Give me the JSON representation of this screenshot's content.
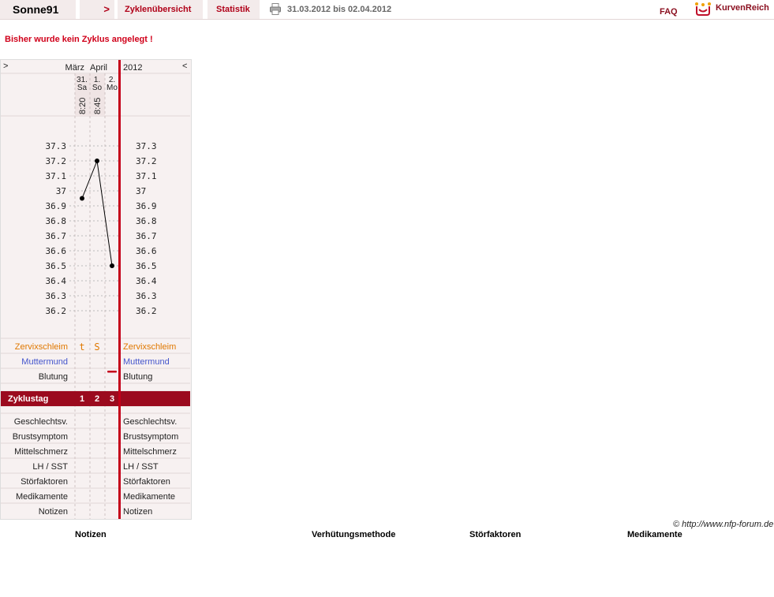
{
  "header": {
    "username": "Sonne91",
    "nav_arrow": ">",
    "cycles_tab": "Zyklenübersicht",
    "statistics_tab": "Statistik",
    "date_range": "31.03.2012 bis 02.04.2012",
    "faq": "FAQ",
    "logo_text": "KurvenReich"
  },
  "notice": "Bisher wurde kein Zyklus angelegt !",
  "chart_header": {
    "prev_arrow": ">",
    "next_arrow": "<",
    "month_1": "März",
    "month_2": "April",
    "year": "2012"
  },
  "chart_data": {
    "type": "line",
    "x": [
      {
        "day": "31.",
        "weekday": "Sa",
        "time": "8:20",
        "temp": 36.95
      },
      {
        "day": "1.",
        "weekday": "So",
        "time": "8:45",
        "temp": 37.2
      },
      {
        "day": "2.",
        "weekday": "Mo",
        "time": "",
        "temp": 36.5
      }
    ],
    "y_ticks": [
      "37.3",
      "37.2",
      "37.1",
      "37",
      "36.9",
      "36.8",
      "36.7",
      "36.6",
      "36.5",
      "36.4",
      "36.3",
      "36.2"
    ],
    "ylim": [
      36.2,
      37.3
    ],
    "series_color": "#000000",
    "rows": {
      "cervical": {
        "label": "Zervixschleim",
        "color": "#e07800",
        "values": [
          "t",
          "S",
          ""
        ]
      },
      "cervix": {
        "label": "Muttermund",
        "color": "#4455cc"
      },
      "bleeding": {
        "label": "Blutung",
        "values": [
          "",
          "",
          "light"
        ]
      },
      "cycle_day": {
        "label": "Zyklustag",
        "values": [
          "1",
          "2",
          "3"
        ],
        "color": "#9b0a1e"
      },
      "extra_rows": [
        "Geschlechtsv.",
        "Brustsymptom",
        "Mittelschmerz",
        "LH / SST",
        "Störfaktoren",
        "Medikamente",
        "Notizen"
      ]
    }
  },
  "footer": {
    "copyright": "© http://www.nfp-forum.de",
    "col_notes": "Notizen",
    "col_method": "Verhütungsmethode",
    "col_disruptions": "Störfaktoren",
    "col_medication": "Medikamente"
  }
}
